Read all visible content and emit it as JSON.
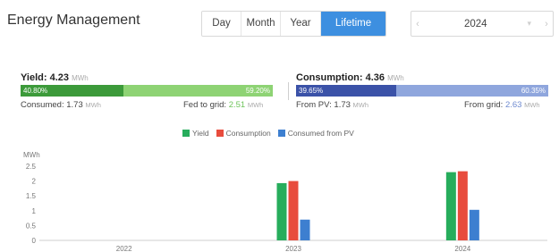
{
  "header": {
    "title": "Energy Management",
    "tabs": [
      {
        "label": "Day",
        "active": false
      },
      {
        "label": "Month",
        "active": false
      },
      {
        "label": "Year",
        "active": false
      },
      {
        "label": "Lifetime",
        "active": true
      }
    ],
    "date_value": "2024",
    "prev_icon": "chevron-left-icon",
    "next_icon": "chevron-right-icon",
    "accent_color": "#3d8fe0"
  },
  "yield": {
    "label": "Yield:",
    "value": "4.23",
    "unit": "MWh",
    "left_pct_label": "40.80%",
    "right_pct_label": "59.20%",
    "left_fraction": 0.408,
    "consumed_label": "Consumed:",
    "consumed_value": "1.73",
    "consumed_unit": "MWh",
    "fed_label": "Fed to grid:",
    "fed_value": "2.51",
    "fed_unit": "MWh",
    "colors": {
      "dark": "#3c9a3a",
      "light": "#8ed374"
    }
  },
  "consumption": {
    "label": "Consumption:",
    "value": "4.36",
    "unit": "MWh",
    "left_pct_label": "39.65%",
    "right_pct_label": "60.35%",
    "left_fraction": 0.3965,
    "from_pv_label": "From PV:",
    "from_pv_value": "1.73",
    "from_pv_unit": "MWh",
    "from_grid_label": "From grid:",
    "from_grid_value": "2.63",
    "from_grid_unit": "MWh",
    "colors": {
      "dark": "#3b52a8",
      "light": "#8fa6dd"
    }
  },
  "chart_data": {
    "type": "bar",
    "ylabel": "MWh",
    "ylim": [
      0,
      2.5
    ],
    "yticks": [
      "2.5",
      "2",
      "1.5",
      "1",
      "0.5",
      "0"
    ],
    "categories": [
      "2022",
      "2023",
      "2024"
    ],
    "series": [
      {
        "name": "Yield",
        "color": "#27ad5c",
        "values": [
          0,
          1.93,
          2.3
        ]
      },
      {
        "name": "Consumption",
        "color": "#e84c3d",
        "values": [
          0,
          2.0,
          2.33
        ]
      },
      {
        "name": "Consumed from PV",
        "color": "#3d7fd0",
        "values": [
          0,
          0.7,
          1.03
        ]
      }
    ],
    "legend_position": "top-center",
    "grid": false
  }
}
